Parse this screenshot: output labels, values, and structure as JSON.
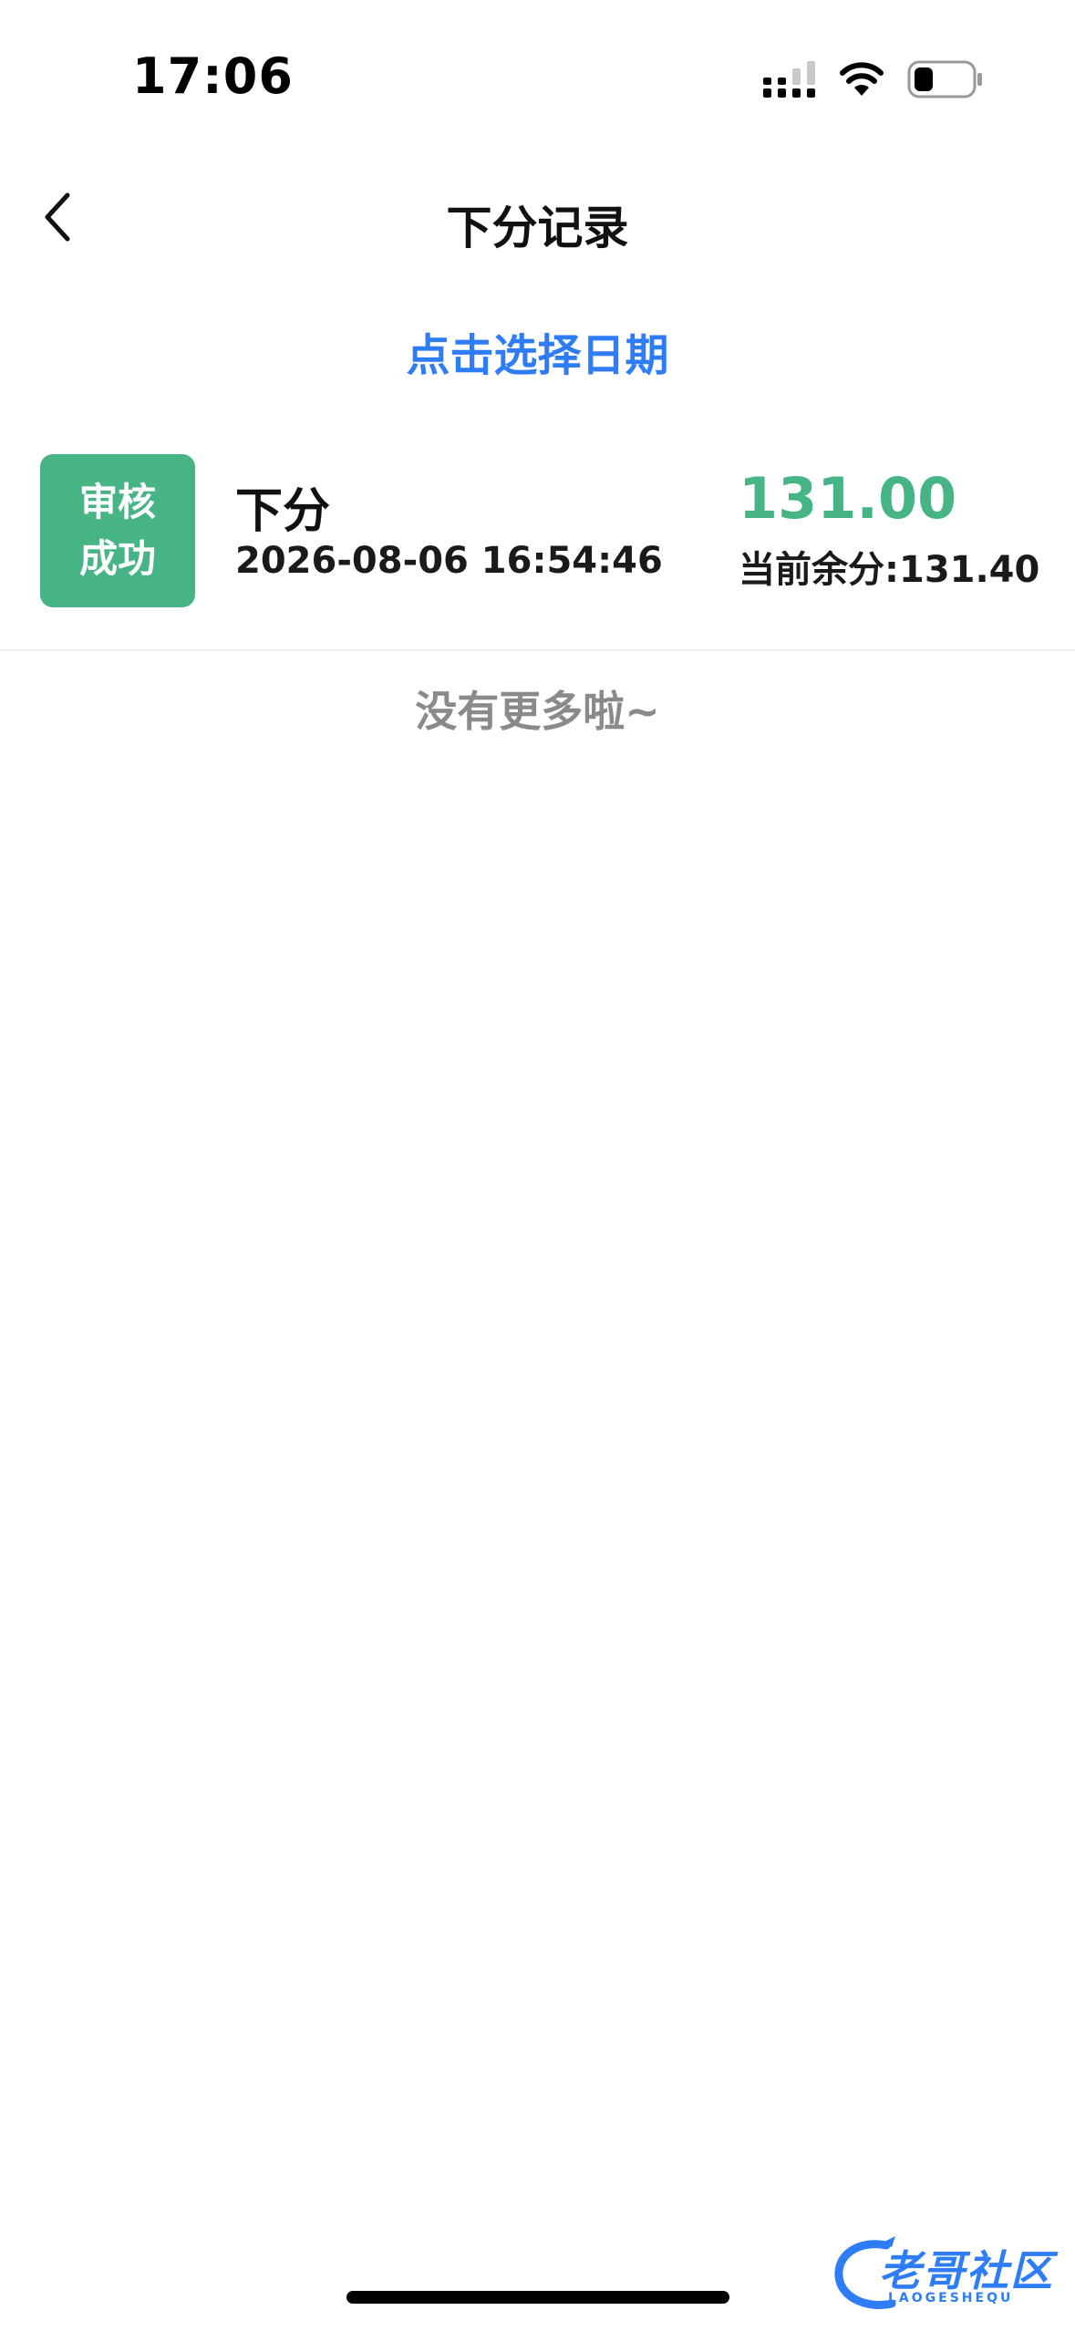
{
  "status_bar": {
    "time": "17:06"
  },
  "nav": {
    "title": "下分记录"
  },
  "date_picker": {
    "label": "点击选择日期"
  },
  "records": [
    {
      "status_line1": "审核",
      "status_line2": "成功",
      "type": "下分",
      "time": "2026-08-06 16:54:46",
      "amount": "131.00",
      "balance": "当前余分:131.40"
    }
  ],
  "footer": {
    "no_more": "没有更多啦~"
  },
  "watermark": {
    "text": "老哥社区",
    "sub": "LAOGESHEQU"
  },
  "colors": {
    "accent_blue": "#2f7df6",
    "success_green": "#46b485",
    "muted_gray": "#8a8a8a"
  },
  "icons": {
    "back": "chevron-left-icon",
    "signal": "cellular-signal-icon",
    "wifi": "wifi-icon",
    "battery": "battery-icon"
  }
}
